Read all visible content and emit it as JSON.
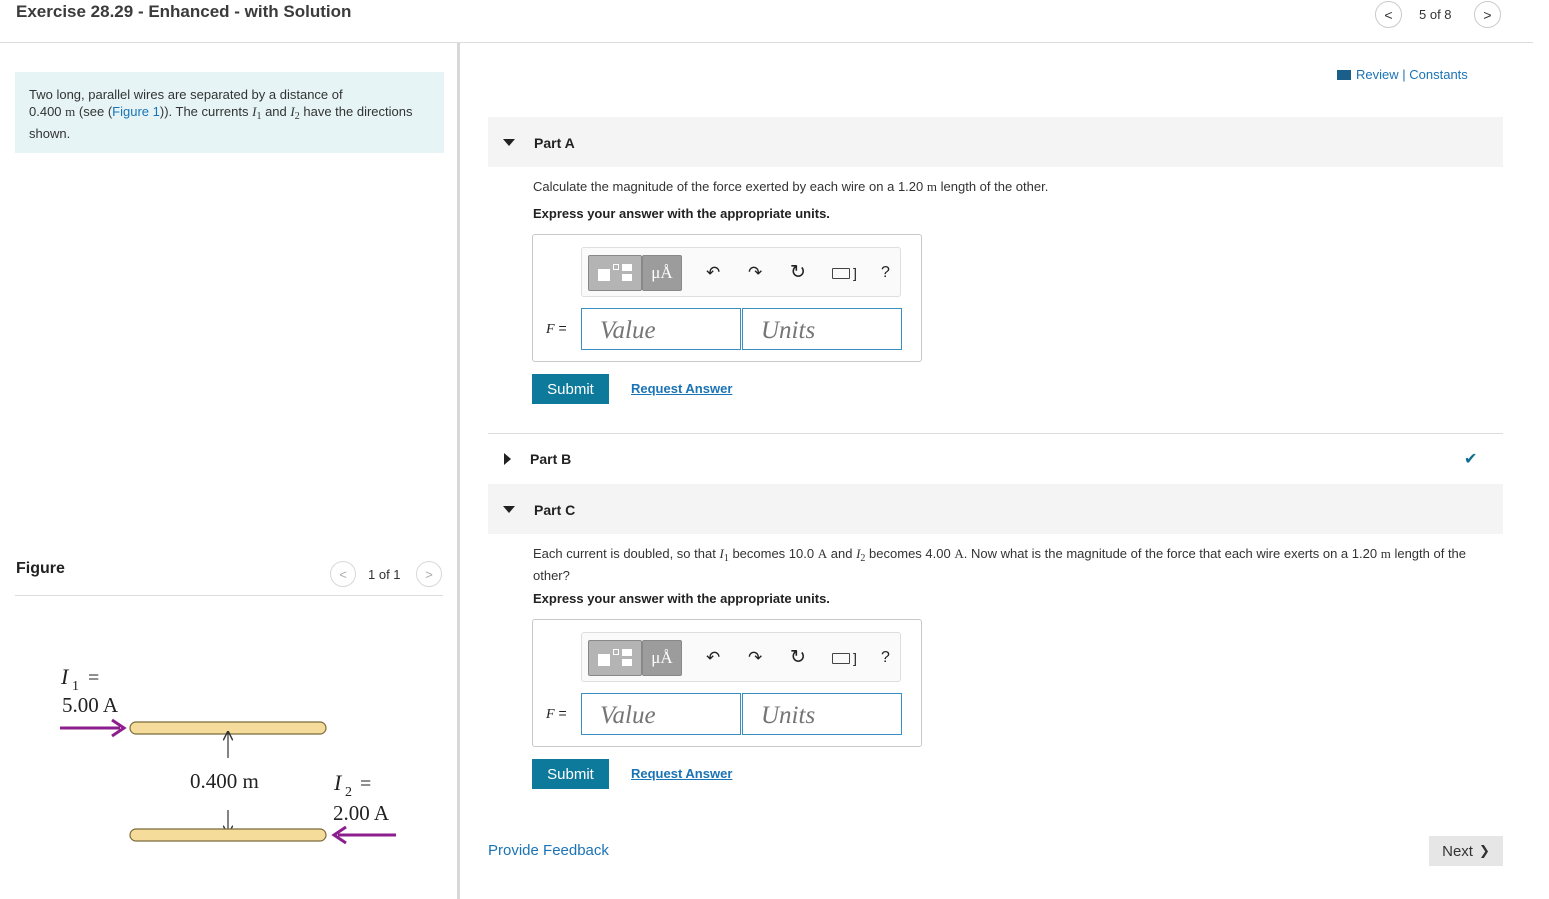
{
  "header": {
    "title": "Exercise 28.29 - Enhanced - with Solution",
    "pager": "5 of 8",
    "prev_glyph": "<",
    "next_glyph": ">"
  },
  "intro": {
    "t1": "Two long, parallel wires are separated by a distance of",
    "dist": "0.400",
    "unit_m": "m",
    "t2": "(see (",
    "figure_link": "Figure 1",
    "t3": ")). The currents",
    "i1_sym": "I",
    "i1_sub": "1",
    "t4": "and",
    "i2_sym": "I",
    "i2_sub": "2",
    "t5": "have the directions shown."
  },
  "figure": {
    "heading": "Figure",
    "pager": "1 of 1",
    "i1_label": "I",
    "i1_sub": "1",
    "i1_eq": "=",
    "i1_value": "5.00 A",
    "i2_label": "I",
    "i2_sub": "2",
    "i2_eq": "=",
    "i2_value": "2.00 A",
    "separation": "0.400 m",
    "colors": {
      "wire_fill": "#f5dc9a",
      "wire_stroke": "#7a6a3a",
      "arrow": "#8c1e8e"
    }
  },
  "links": {
    "review": "Review",
    "separator": "|",
    "constants": "Constants"
  },
  "part_a": {
    "label": "Part A",
    "q1": "Calculate the magnitude of the force exerted by each wire on a",
    "q_val": "1.20",
    "q_unit": "m",
    "q2": "length of the other.",
    "instruction": "Express your answer with the appropriate units.",
    "var": "F",
    "eq": "=",
    "value_placeholder": "Value",
    "units_placeholder": "Units",
    "submit": "Submit",
    "request": "Request Answer"
  },
  "part_b": {
    "label": "Part B",
    "status": "correct",
    "check_glyph": "✔"
  },
  "part_c": {
    "label": "Part C",
    "q1": "Each current is doubled, so that",
    "i1_sym": "I",
    "i1_sub": "1",
    "q2": "becomes 10.0",
    "unit_A": "A",
    "q3": "and",
    "i2_sym": "I",
    "i2_sub": "2",
    "q4": "becomes 4.00",
    "unit_A2": "A",
    "q5": ". Now what is the magnitude of the force that each wire exerts on a 1.20",
    "unit_m": "m",
    "q6": "length of the other?",
    "instruction": "Express your answer with the appropriate units.",
    "var": "F",
    "eq": "=",
    "value_placeholder": "Value",
    "units_placeholder": "Units",
    "submit": "Submit",
    "request": "Request Answer"
  },
  "toolbar": {
    "units_glyph": "μÅ",
    "undo_glyph": "↶",
    "redo_glyph": "↷",
    "reset_glyph": "↻",
    "keyboard_bracket": "]",
    "help_glyph": "?"
  },
  "footer": {
    "feedback": "Provide Feedback",
    "next": "Next",
    "next_glyph": "❯"
  },
  "colors": {
    "accent": "#0d7a9c",
    "link": "#1a73b5",
    "intro_bg": "#e6f4f6",
    "check": "#0d6e91"
  }
}
